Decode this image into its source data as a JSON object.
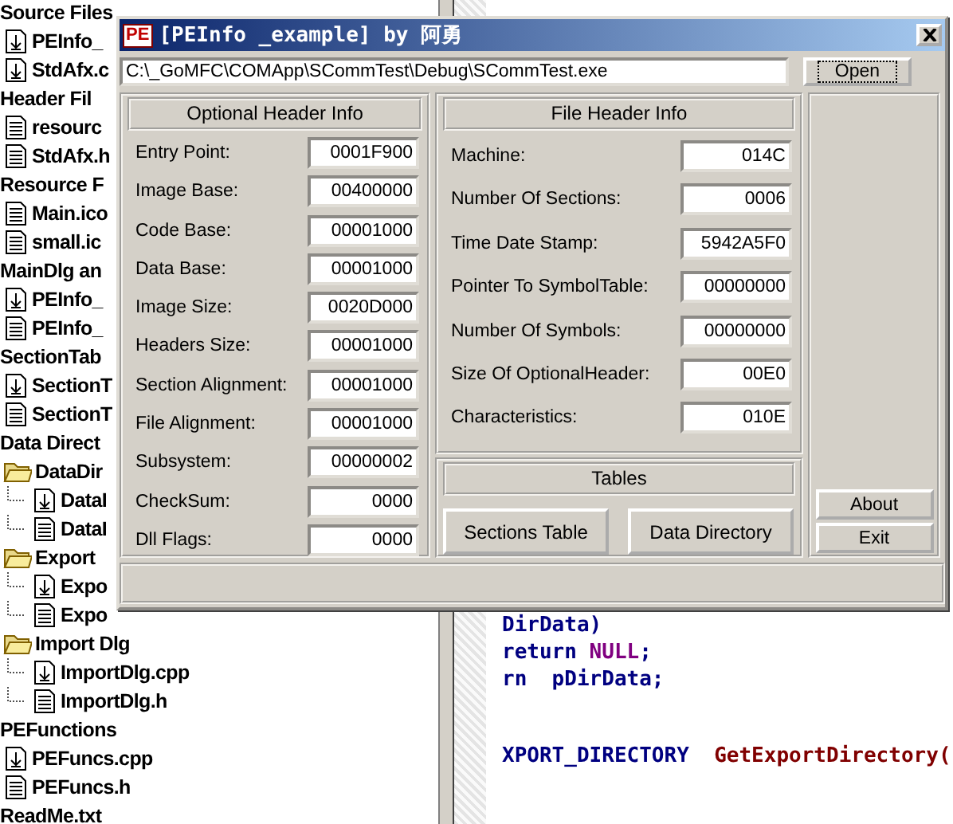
{
  "project_tree": {
    "items": [
      {
        "label": "Source Files",
        "kind": "group",
        "children": [
          {
            "label": "PEInfo_",
            "kind": "source"
          },
          {
            "label": "StdAfx.c",
            "kind": "source"
          }
        ]
      },
      {
        "label": "Header Fil",
        "kind": "group",
        "children": [
          {
            "label": "resourc",
            "kind": "document"
          },
          {
            "label": "StdAfx.h",
            "kind": "document"
          }
        ]
      },
      {
        "label": "Resource F",
        "kind": "group",
        "children": [
          {
            "label": "Main.ico",
            "kind": "document"
          },
          {
            "label": "small.ic",
            "kind": "document"
          }
        ]
      },
      {
        "label": "MainDlg an",
        "kind": "group",
        "children": [
          {
            "label": "PEInfo_",
            "kind": "source"
          },
          {
            "label": "PEInfo_",
            "kind": "document"
          }
        ]
      },
      {
        "label": "SectionTab",
        "kind": "group",
        "children": [
          {
            "label": "SectionT",
            "kind": "source"
          },
          {
            "label": "SectionT",
            "kind": "document"
          }
        ]
      },
      {
        "label": "Data Direct",
        "kind": "group",
        "children": [
          {
            "label": "DataDir",
            "kind": "folder",
            "children": [
              {
                "label": "DataI",
                "kind": "source"
              },
              {
                "label": "DataI",
                "kind": "document"
              }
            ]
          },
          {
            "label": "Export",
            "kind": "folder",
            "children": [
              {
                "label": "Expo",
                "kind": "source"
              },
              {
                "label": "Expo",
                "kind": "document"
              }
            ]
          },
          {
            "label": "Import Dlg",
            "kind": "folder",
            "children": [
              {
                "label": "ImportDlg.cpp",
                "kind": "source"
              },
              {
                "label": "ImportDlg.h",
                "kind": "document"
              }
            ]
          }
        ]
      },
      {
        "label": "PEFunctions",
        "kind": "group",
        "children": [
          {
            "label": "PEFuncs.cpp",
            "kind": "source"
          },
          {
            "label": "PEFuncs.h",
            "kind": "document"
          }
        ]
      },
      {
        "label": "ReadMe.txt",
        "kind": "group"
      }
    ]
  },
  "code_editor": {
    "blocks": [
      {
        "lines": [
          [
            {
              "text": "DirData)",
              "kind": "text"
            }
          ],
          [
            {
              "text": "return ",
              "kind": "text"
            },
            {
              "text": "NULL",
              "kind": "macro"
            },
            {
              "text": ";",
              "kind": "text"
            }
          ],
          [
            {
              "text": "rn  pDirData;",
              "kind": "text"
            }
          ]
        ]
      },
      {
        "lines": [
          [
            {
              "text": "XPORT_DIRECTORY  ",
              "kind": "text"
            },
            {
              "text": "GetExportDirectory(",
              "kind": "function"
            }
          ]
        ]
      }
    ]
  },
  "dialog": {
    "icon_text": "PE",
    "title": "[PEInfo _example] by 阿勇",
    "path_field": {
      "value": "C:\\_GoMFC\\COMApp\\SCommTest\\Debug\\SCommTest.exe"
    },
    "open_button": "Open",
    "optional_header": {
      "title": "Optional Header Info",
      "rows": [
        {
          "label": "Entry Point:",
          "value": "0001F900"
        },
        {
          "label": "Image Base:",
          "value": "00400000"
        },
        {
          "label": "Code Base:",
          "value": "00001000"
        },
        {
          "label": "Data Base:",
          "value": "00001000"
        },
        {
          "label": "Image Size:",
          "value": "0020D000"
        },
        {
          "label": "Headers Size:",
          "value": "00001000"
        },
        {
          "label": "Section Alignment:",
          "value": "00001000"
        },
        {
          "label": "File Alignment:",
          "value": "00001000"
        },
        {
          "label": "Subsystem:",
          "value": "00000002"
        },
        {
          "label": "CheckSum:",
          "value": "0000"
        },
        {
          "label": "Dll Flags:",
          "value": "0000"
        }
      ]
    },
    "file_header": {
      "title": "File Header Info",
      "rows": [
        {
          "label": "Machine:",
          "value": "014C"
        },
        {
          "label": "Number Of Sections:",
          "value": "0006"
        },
        {
          "label": "Time Date Stamp:",
          "value": "5942A5F0"
        },
        {
          "label": "Pointer To SymbolTable:",
          "value": "00000000"
        },
        {
          "label": "Number Of Symbols:",
          "value": "00000000"
        },
        {
          "label": "Size Of OptionalHeader:",
          "value": "00E0"
        },
        {
          "label": "Characteristics:",
          "value": "010E"
        }
      ]
    },
    "tables": {
      "title": "Tables",
      "buttons": [
        "Sections Table",
        "Data Directory"
      ]
    },
    "side_buttons": [
      "About",
      "Exit"
    ]
  }
}
